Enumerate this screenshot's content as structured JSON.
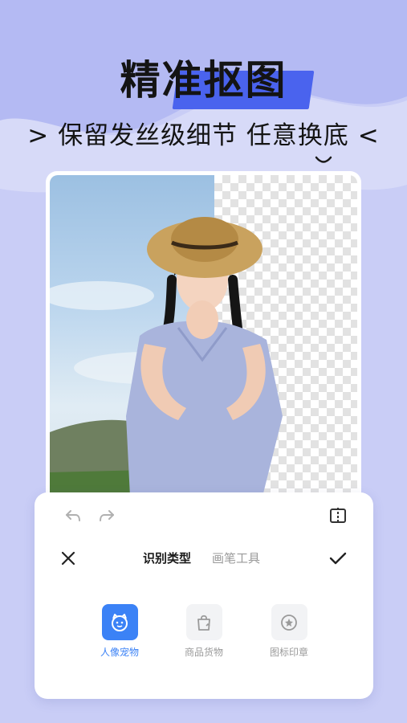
{
  "header": {
    "title": "精准抠图",
    "subtitle": "> 保留发丝级细节 任意换底 <"
  },
  "preview": {
    "image_desc": "portrait-with-background-removed"
  },
  "toolbar": {
    "undo_icon": "undo-icon",
    "redo_icon": "redo-icon",
    "compare_icon": "compare-icon"
  },
  "tabs": [
    {
      "label": "识别类型",
      "active": true
    },
    {
      "label": "画笔工具",
      "active": false
    }
  ],
  "actions": {
    "close_icon": "close-icon",
    "confirm_icon": "check-icon"
  },
  "types": [
    {
      "label": "人像宠物",
      "icon": "pet-face-icon",
      "selected": true
    },
    {
      "label": "商品货物",
      "icon": "shopping-bag-icon",
      "selected": false
    },
    {
      "label": "图标印章",
      "icon": "stamp-icon",
      "selected": false
    }
  ],
  "colors": {
    "accent": "#3b82f6",
    "background": "#c9cdf6",
    "highlight_bar": "#4a63ee"
  }
}
